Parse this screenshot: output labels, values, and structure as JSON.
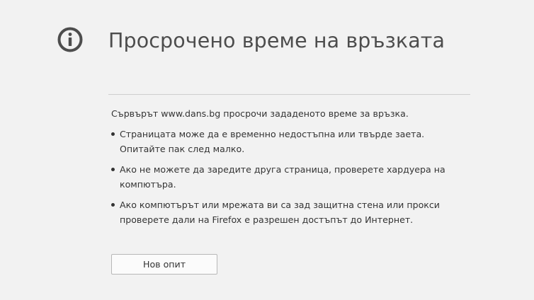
{
  "error": {
    "icon": "info-icon",
    "title": "Просрочено време на връзката",
    "summary": "Сървърът www.dans.bg просрочи зададеното време за връзка.",
    "reasons": [
      "Страницата може да е временно недостъпна или твърде заета. Опитайте пак след малко.",
      "Ако не можете да заредите друга страница, проверете хардуера на компютъра.",
      "Ако компютърът или мрежата ви са зад защитна стена или прокси проверете дали на Firefox е разрешен достъпът до Интернет."
    ],
    "retry_label": "Нов опит"
  },
  "colors": {
    "background": "#f2f2f2",
    "icon": "#4d4d4d",
    "divider": "#cfcfcf",
    "text": "#333333"
  }
}
